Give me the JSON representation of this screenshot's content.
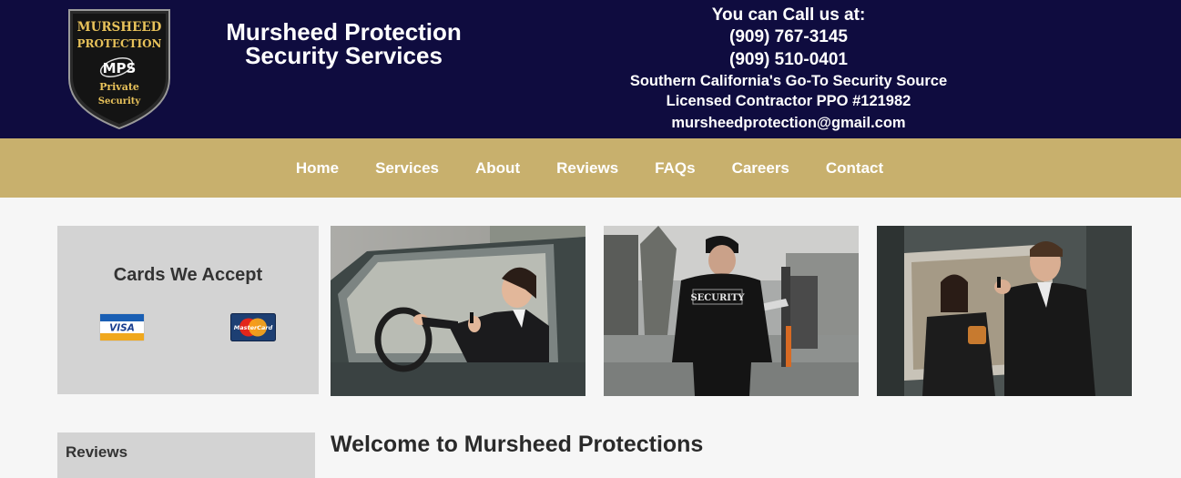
{
  "logo": {
    "line1": "MURSHEED",
    "line2": "PROTECTION",
    "mark": "MPS",
    "line3": "Private",
    "line4": "Security"
  },
  "brand": {
    "line1": "Mursheed Protection",
    "line2": "Security Services"
  },
  "contact": {
    "heading": "You can Call us at:",
    "phone1": "(909) 767-3145",
    "phone2": "(909) 510-0401",
    "tagline": "Southern California's Go-To Security Source",
    "license": "Licensed Contractor PPO #121982",
    "email": "mursheedprotection@gmail.com"
  },
  "nav": {
    "items": [
      "Home",
      "Services",
      "About",
      "Reviews",
      "FAQs",
      "Careers",
      "Contact"
    ]
  },
  "cards": {
    "title": "Cards We Accept",
    "visa": "VISA",
    "mastercard": "MasterCard"
  },
  "photos": {
    "security_jacket_text": "SECURITY"
  },
  "sidebar": {
    "reviews_title": "Reviews"
  },
  "main": {
    "heading": "Welcome to Mursheed Protections"
  },
  "colors": {
    "header_bg": "#0f0c3f",
    "nav_bg": "#c8b06d",
    "panel_bg": "#d3d3d3",
    "logo_gold": "#e8c25a"
  }
}
